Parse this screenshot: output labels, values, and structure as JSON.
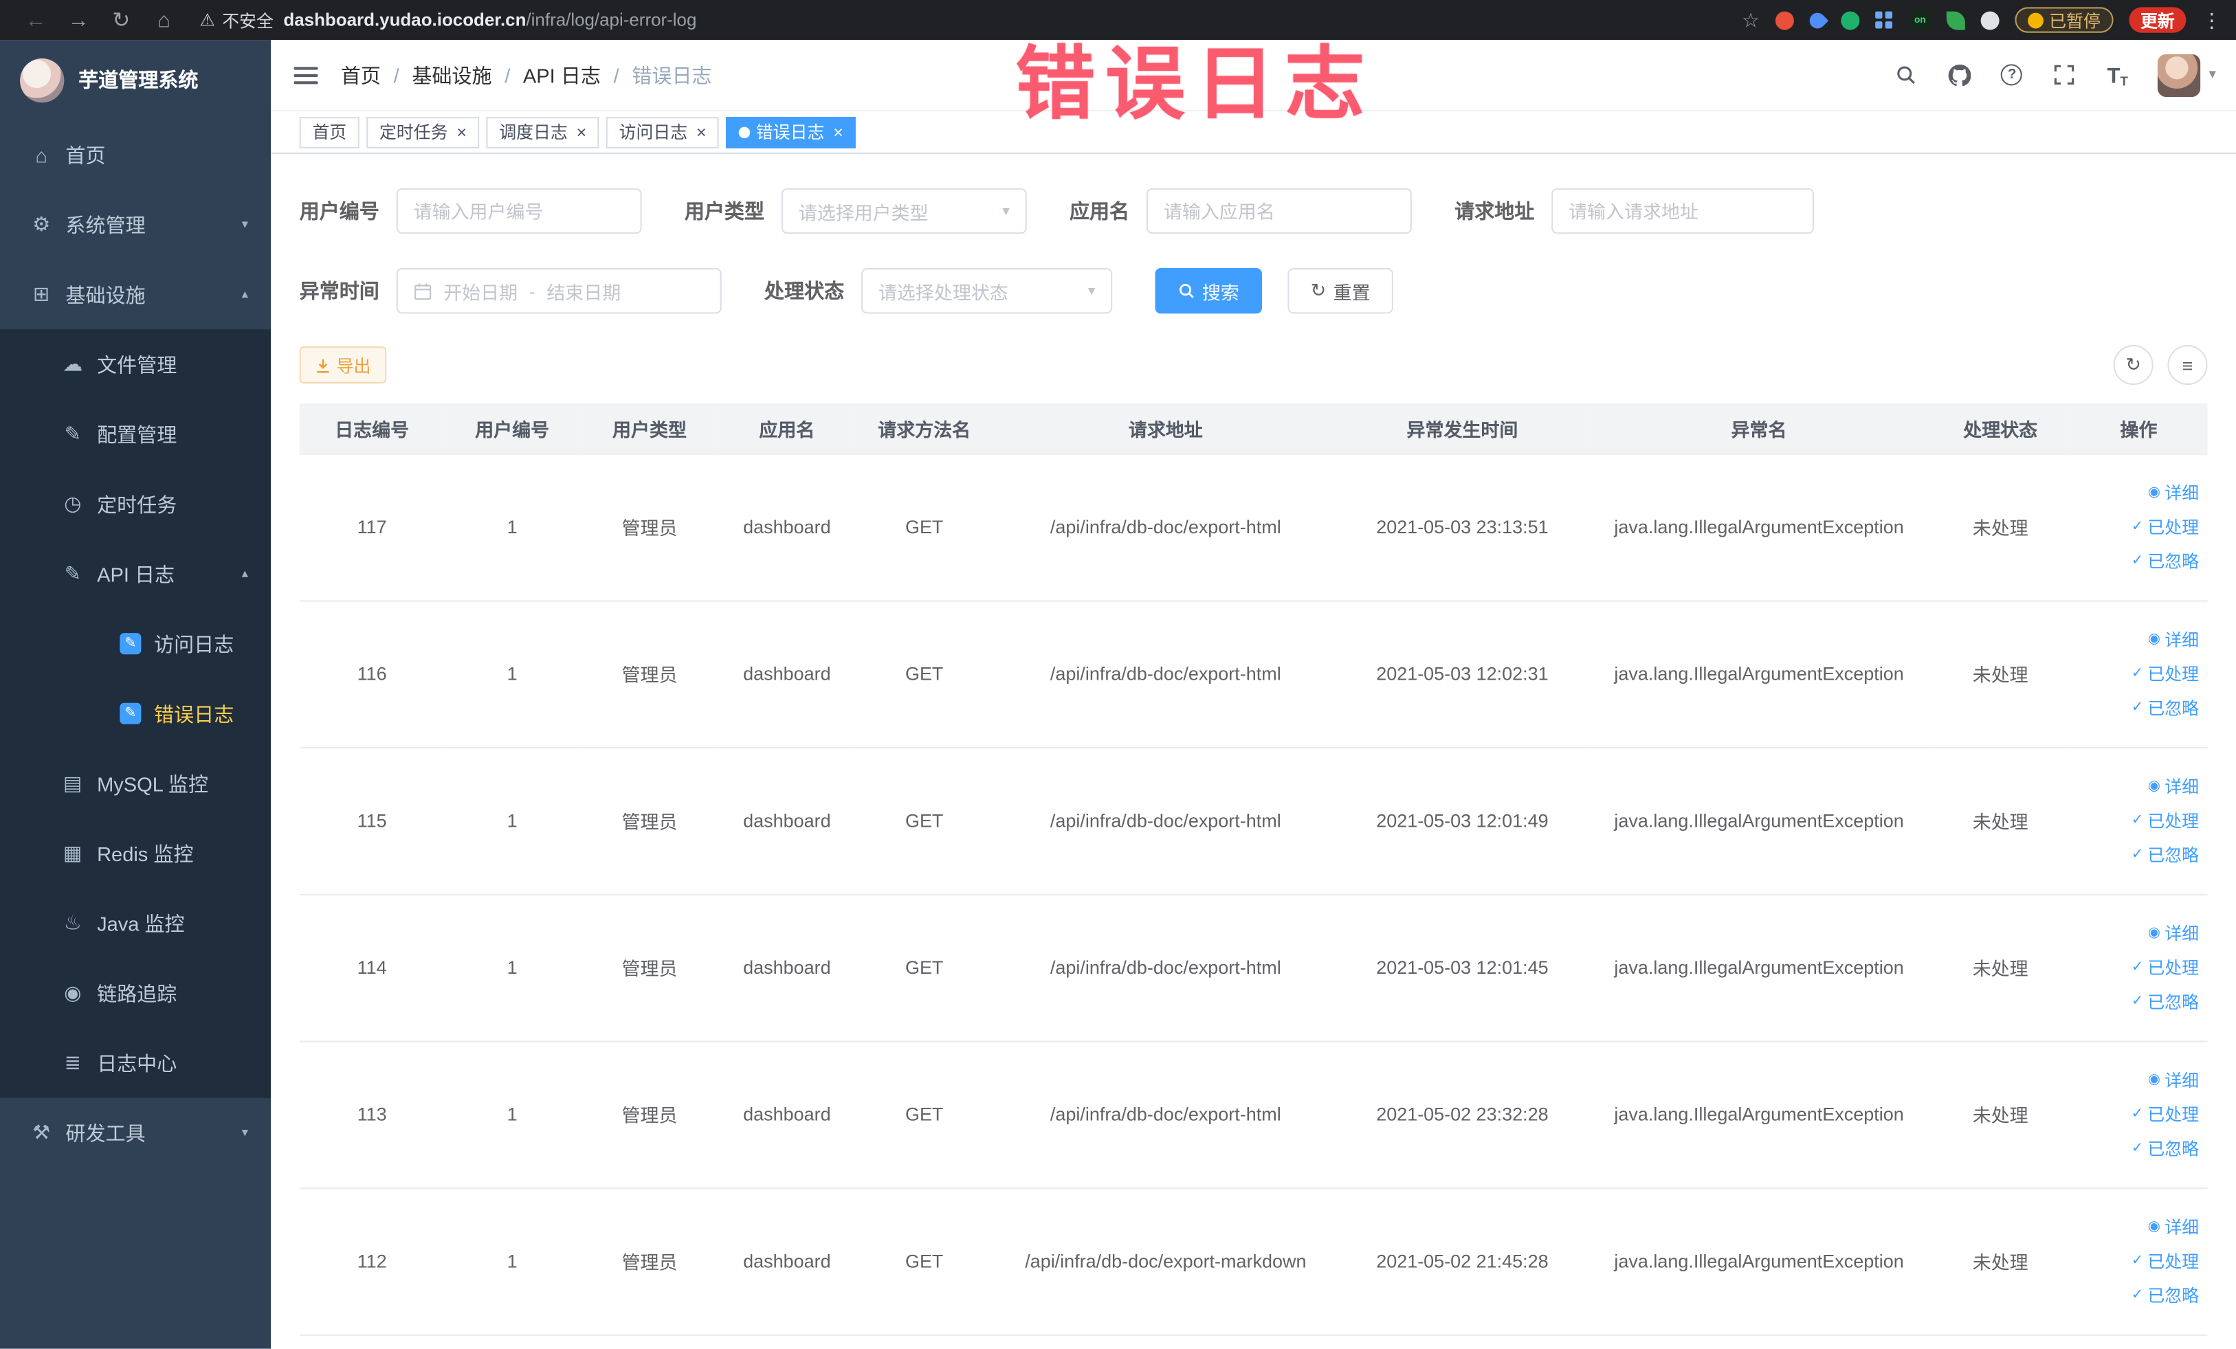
{
  "colors": {
    "accent": "#409eff",
    "menu_active_text": "#ffd04b",
    "warning": "#e6a23c",
    "overlay_red": "#fb4e63",
    "sidebar_bg": "#304156",
    "submenu_bg": "#1f2d3d"
  },
  "icons": {
    "back": "←",
    "forward": "→",
    "reload": "↻",
    "home": "⌂",
    "warning": "⚠",
    "star": "☆",
    "kebab": "⋮",
    "question": "?",
    "fontsize_large": "T",
    "fontsize_small": "T",
    "caret": "▾",
    "chevron_up": "▴",
    "chevron_down": "▾",
    "refresh": "↻",
    "columns": "≡",
    "separator": "/",
    "close": "×"
  },
  "browser": {
    "security_label": "不安全",
    "url_host": "dashboard.yudao.iocoder.cn",
    "url_path": "/infra/log/api-error-log",
    "paused_badge": "已暂停",
    "update_button": "更新"
  },
  "overlay": {
    "title": "错误日志"
  },
  "sidebar": {
    "logo_title": "芋道管理系统",
    "items": [
      {
        "id": "home",
        "label": "首页",
        "level": 1,
        "glyph": "⌂",
        "icon": "home-icon",
        "arrow": null,
        "active": false,
        "blue": false
      },
      {
        "id": "system-management",
        "label": "系统管理",
        "level": 1,
        "glyph": "⚙",
        "icon": "gear-icon",
        "arrow": "down",
        "active": false,
        "blue": false
      },
      {
        "id": "infrastructure",
        "label": "基础设施",
        "level": 1,
        "glyph": "⊞",
        "icon": "grid-icon",
        "arrow": "up",
        "active": false,
        "blue": false
      },
      {
        "id": "file-management",
        "label": "文件管理",
        "level": 2,
        "glyph": "☁",
        "icon": "cloud-icon",
        "arrow": null,
        "active": false,
        "blue": false
      },
      {
        "id": "config-management",
        "label": "配置管理",
        "level": 2,
        "glyph": "✎",
        "icon": "edit-icon",
        "arrow": null,
        "active": false,
        "blue": false
      },
      {
        "id": "scheduled-jobs",
        "label": "定时任务",
        "level": 2,
        "glyph": "◷",
        "icon": "clock-icon",
        "arrow": null,
        "active": false,
        "blue": false
      },
      {
        "id": "api-log",
        "label": "API 日志",
        "level": 2,
        "glyph": "✎",
        "icon": "log-icon",
        "arrow": "up",
        "active": false,
        "blue": false
      },
      {
        "id": "access-log",
        "label": "访问日志",
        "level": 3,
        "glyph": "✎",
        "icon": "edit-square-icon",
        "arrow": null,
        "active": false,
        "blue": true
      },
      {
        "id": "error-log",
        "label": "错误日志",
        "level": 3,
        "glyph": "✎",
        "icon": "edit-square-icon",
        "arrow": null,
        "active": true,
        "blue": true
      },
      {
        "id": "mysql-monitor",
        "label": "MySQL 监控",
        "level": 2,
        "glyph": "▤",
        "icon": "database-icon",
        "arrow": null,
        "active": false,
        "blue": false
      },
      {
        "id": "redis-monitor",
        "label": "Redis 监控",
        "level": 2,
        "glyph": "▦",
        "icon": "layers-icon",
        "arrow": null,
        "active": false,
        "blue": false
      },
      {
        "id": "java-monitor",
        "label": "Java 监控",
        "level": 2,
        "glyph": "♨",
        "icon": "java-icon",
        "arrow": null,
        "active": false,
        "blue": false
      },
      {
        "id": "tracing",
        "label": "链路追踪",
        "level": 2,
        "glyph": "◉",
        "icon": "eye-icon",
        "arrow": null,
        "active": false,
        "blue": false
      },
      {
        "id": "log-center",
        "label": "日志中心",
        "level": 2,
        "glyph": "≣",
        "icon": "document-icon",
        "arrow": null,
        "active": false,
        "blue": false
      },
      {
        "id": "dev-tools",
        "label": "研发工具",
        "level": 1,
        "glyph": "⚒",
        "icon": "tools-icon",
        "arrow": "down",
        "active": false,
        "blue": false
      }
    ]
  },
  "breadcrumb": {
    "items": [
      "首页",
      "基础设施",
      "API 日志",
      "错误日志"
    ]
  },
  "tabs": [
    {
      "id": "home",
      "label": "首页",
      "closable": false,
      "active": false
    },
    {
      "id": "scheduled-jobs",
      "label": "定时任务",
      "closable": true,
      "active": false
    },
    {
      "id": "schedule-log",
      "label": "调度日志",
      "closable": true,
      "active": false
    },
    {
      "id": "access-log",
      "label": "访问日志",
      "closable": true,
      "active": false
    },
    {
      "id": "error-log",
      "label": "错误日志",
      "closable": true,
      "active": true
    }
  ],
  "filters": {
    "user_id": {
      "label": "用户编号",
      "placeholder": "请输入用户编号"
    },
    "user_type": {
      "label": "用户类型",
      "placeholder": "请选择用户类型"
    },
    "app_name": {
      "label": "应用名",
      "placeholder": "请输入应用名"
    },
    "request_url": {
      "label": "请求地址",
      "placeholder": "请输入请求地址"
    },
    "exception_time": {
      "label": "异常时间",
      "start_placeholder": "开始日期",
      "separator": "-",
      "end_placeholder": "结束日期"
    },
    "process_status": {
      "label": "处理状态",
      "placeholder": "请选择处理状态"
    },
    "search_button": "搜索",
    "reset_button": "重置"
  },
  "toolbar": {
    "export_button": "导出"
  },
  "table": {
    "headers": [
      "日志编号",
      "用户编号",
      "用户类型",
      "应用名",
      "请求方法名",
      "请求地址",
      "异常发生时间",
      "异常名",
      "处理状态",
      "操作"
    ],
    "actions": [
      {
        "id": "detail",
        "label": "详细",
        "icon": "eye-icon",
        "glyph": "◉"
      },
      {
        "id": "processed",
        "label": "已处理",
        "icon": "check-icon",
        "glyph": "✓"
      },
      {
        "id": "ignored",
        "label": "已忽略",
        "icon": "check-icon",
        "glyph": "✓"
      }
    ],
    "rows": [
      {
        "id": "117",
        "user_id": "1",
        "user_type": "管理员",
        "app": "dashboard",
        "method": "GET",
        "url": "/api/infra/db-doc/export-html",
        "time": "2021-05-03 23:13:51",
        "exception": "java.lang.IllegalArgumentException",
        "status": "未处理"
      },
      {
        "id": "116",
        "user_id": "1",
        "user_type": "管理员",
        "app": "dashboard",
        "method": "GET",
        "url": "/api/infra/db-doc/export-html",
        "time": "2021-05-03 12:02:31",
        "exception": "java.lang.IllegalArgumentException",
        "status": "未处理"
      },
      {
        "id": "115",
        "user_id": "1",
        "user_type": "管理员",
        "app": "dashboard",
        "method": "GET",
        "url": "/api/infra/db-doc/export-html",
        "time": "2021-05-03 12:01:49",
        "exception": "java.lang.IllegalArgumentException",
        "status": "未处理"
      },
      {
        "id": "114",
        "user_id": "1",
        "user_type": "管理员",
        "app": "dashboard",
        "method": "GET",
        "url": "/api/infra/db-doc/export-html",
        "time": "2021-05-03 12:01:45",
        "exception": "java.lang.IllegalArgumentException",
        "status": "未处理"
      },
      {
        "id": "113",
        "user_id": "1",
        "user_type": "管理员",
        "app": "dashboard",
        "method": "GET",
        "url": "/api/infra/db-doc/export-html",
        "time": "2021-05-02 23:32:28",
        "exception": "java.lang.IllegalArgumentException",
        "status": "未处理"
      },
      {
        "id": "112",
        "user_id": "1",
        "user_type": "管理员",
        "app": "dashboard",
        "method": "GET",
        "url": "/api/infra/db-doc/export-markdown",
        "time": "2021-05-02 21:45:28",
        "exception": "java.lang.IllegalArgumentException",
        "status": "未处理"
      }
    ]
  }
}
